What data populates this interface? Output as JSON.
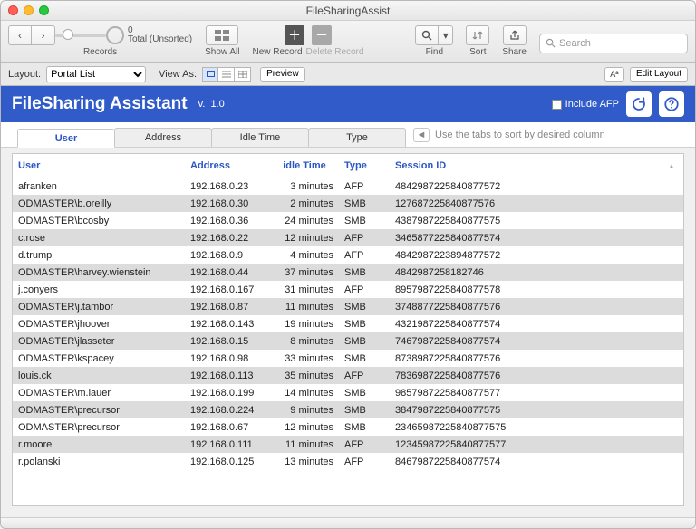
{
  "window": {
    "title": "FileSharingAssist"
  },
  "toolbar": {
    "total_label": "Total (Unsorted)",
    "total_count": "0",
    "records_label": "Records",
    "showall_label": "Show All",
    "newrecord_label": "New Record",
    "deleterecord_label": "Delete Record",
    "find_label": "Find",
    "sort_label": "Sort",
    "share_label": "Share",
    "search_placeholder": "Search"
  },
  "layoutbar": {
    "layout_label": "Layout:",
    "layout_selected": "Portal List",
    "viewas_label": "View As:",
    "preview_label": "Preview",
    "aa_label": "Aª",
    "edit_label": "Edit Layout"
  },
  "header": {
    "title": "FileSharing Assistant",
    "version_prefix": "v.",
    "version": "1.0",
    "include_afp_label": "Include AFP"
  },
  "tabs": {
    "items": [
      "User",
      "Address",
      "Idle Time",
      "Type"
    ],
    "active_index": 0,
    "hint": "Use the tabs to sort by desired column"
  },
  "columns": {
    "user": "User",
    "address": "Address",
    "idle": "idle Time",
    "type": "Type",
    "session": "Session ID"
  },
  "rows": [
    {
      "user": "afranken",
      "address": "192.168.0.23",
      "idle": "3 minutes",
      "type": "AFP",
      "session": "4842987225840877572"
    },
    {
      "user": "ODMASTER\\b.oreilly",
      "address": "192.168.0.30",
      "idle": "2 minutes",
      "type": "SMB",
      "session": "127687225840877576"
    },
    {
      "user": "ODMASTER\\bcosby",
      "address": "192.168.0.36",
      "idle": "24 minutes",
      "type": "SMB",
      "session": "4387987225840877575"
    },
    {
      "user": "c.rose",
      "address": "192.168.0.22",
      "idle": "12 minutes",
      "type": "AFP",
      "session": "3465877225840877574"
    },
    {
      "user": "d.trump",
      "address": "192.168.0.9",
      "idle": "4 minutes",
      "type": "AFP",
      "session": "4842987223894877572"
    },
    {
      "user": "ODMASTER\\harvey.wienstein",
      "address": "192.168.0.44",
      "idle": "37 minutes",
      "type": "SMB",
      "session": "4842987258182746"
    },
    {
      "user": "j.conyers",
      "address": "192.168.0.167",
      "idle": "31 minutes",
      "type": "AFP",
      "session": "8957987225840877578"
    },
    {
      "user": "ODMASTER\\j.tambor",
      "address": "192.168.0.87",
      "idle": "11 minutes",
      "type": "SMB",
      "session": "3748877225840877576"
    },
    {
      "user": "ODMASTER\\jhoover",
      "address": "192.168.0.143",
      "idle": "19 minutes",
      "type": "SMB",
      "session": "4321987225840877574"
    },
    {
      "user": "ODMASTER\\jlasseter",
      "address": "192.168.0.15",
      "idle": "8 minutes",
      "type": "SMB",
      "session": "7467987225840877574"
    },
    {
      "user": "ODMASTER\\kspacey",
      "address": "192.168.0.98",
      "idle": "33 minutes",
      "type": "SMB",
      "session": "8738987225840877576"
    },
    {
      "user": "louis.ck",
      "address": "192.168.0.113",
      "idle": "35 minutes",
      "type": "AFP",
      "session": "7836987225840877576"
    },
    {
      "user": "ODMASTER\\m.lauer",
      "address": "192.168.0.199",
      "idle": "14 minutes",
      "type": "SMB",
      "session": "9857987225840877577"
    },
    {
      "user": "ODMASTER\\precursor",
      "address": "192.168.0.224",
      "idle": "9 minutes",
      "type": "SMB",
      "session": "3847987225840877575"
    },
    {
      "user": "ODMASTER\\precursor",
      "address": "192.168.0.67",
      "idle": "12 minutes",
      "type": "SMB",
      "session": "23465987225840877575"
    },
    {
      "user": "r.moore",
      "address": "192.168.0.111",
      "idle": "11 minutes",
      "type": "AFP",
      "session": "12345987225840877577"
    },
    {
      "user": "r.polanski",
      "address": "192.168.0.125",
      "idle": "13 minutes",
      "type": "AFP",
      "session": "8467987225840877574"
    }
  ]
}
